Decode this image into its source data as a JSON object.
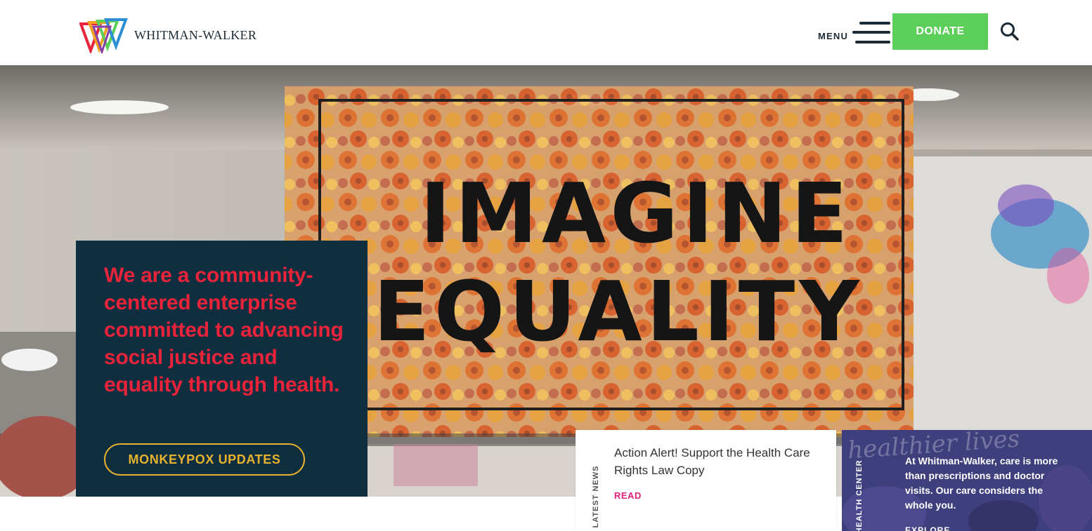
{
  "header": {
    "logo_text": "WHITMAN-WALKER",
    "menu_label": "MENU",
    "donate_label": "DONATE"
  },
  "hero": {
    "sign_line1": "IMAGINE",
    "sign_line2": "EQUALITY",
    "statement": "We are a community-centered enterprise committed to advancing social justice and equality through health.",
    "cta_label": "MONKEYPOX UPDATES"
  },
  "news": {
    "side_label": "LATEST NEWS",
    "title": "Action Alert! Support the Health Care Rights Law Copy",
    "read_label": "READ"
  },
  "health_center": {
    "side_label": "HEALTH CENTER",
    "script_text": "healthier lives",
    "text": "At Whitman-Walker, care is more than prescriptions and doctor visits. Our care considers the whole you.",
    "explore_label": "EXPLORE"
  },
  "colors": {
    "navy": "#0f2e3f",
    "red": "#e8233a",
    "gold": "#e7b22d",
    "green": "#5cce5a",
    "pink": "#e2227a",
    "purple": "#3f3f7d"
  },
  "icons": [
    "logo-triangles-icon",
    "hamburger-icon",
    "search-icon"
  ]
}
